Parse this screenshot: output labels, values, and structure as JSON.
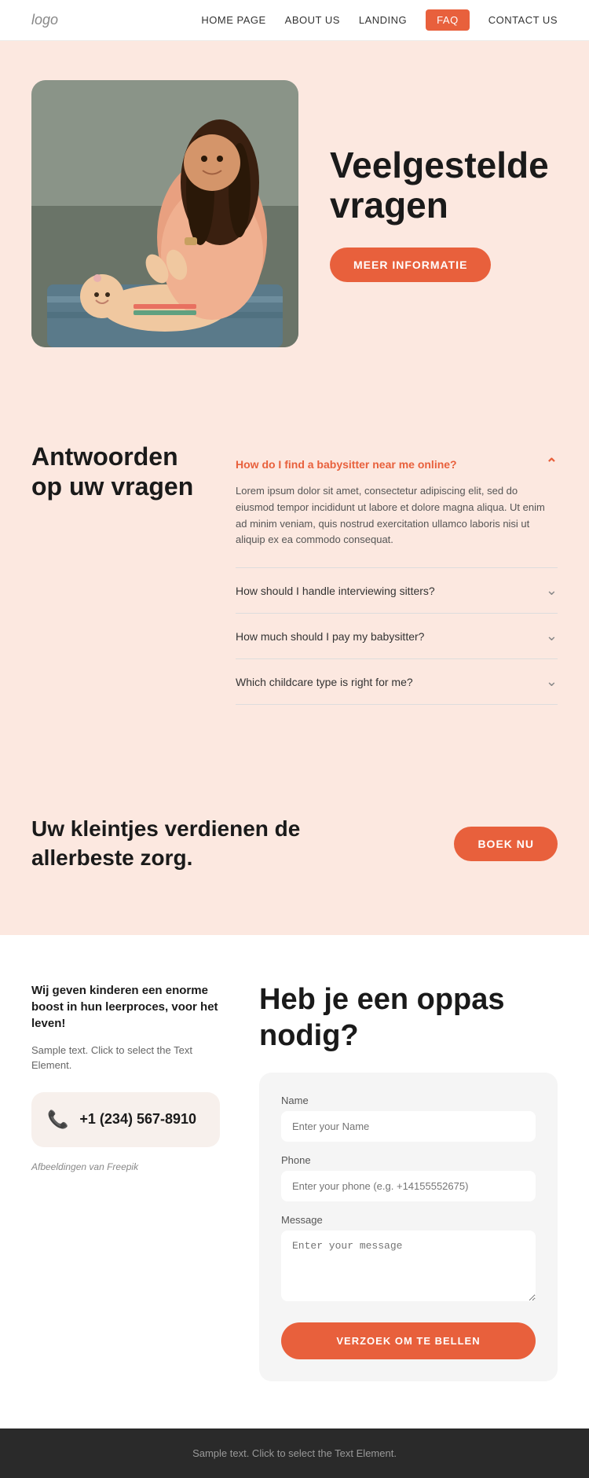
{
  "nav": {
    "logo": "logo",
    "links": [
      {
        "label": "HOME PAGE",
        "key": "home",
        "active": false
      },
      {
        "label": "ABOUT US",
        "key": "about",
        "active": false
      },
      {
        "label": "LANDING",
        "key": "landing",
        "active": false
      },
      {
        "label": "FAQ",
        "key": "faq",
        "active": true
      },
      {
        "label": "CONTACT US",
        "key": "contact",
        "active": false
      }
    ]
  },
  "hero": {
    "title": "Veelgestelde vragen",
    "cta_button": "MEER INFORMATIE"
  },
  "faq_section": {
    "heading": "Antwoorden op uw vragen",
    "items": [
      {
        "question": "How do I find a babysitter near me online?",
        "answer": "Lorem ipsum dolor sit amet, consectetur adipiscing elit, sed do eiusmod tempor incididunt ut labore et dolore magna aliqua. Ut enim ad minim veniam, quis nostrud exercitation ullamco laboris nisi ut aliquip ex ea commodo consequat.",
        "open": true
      },
      {
        "question": "How should I handle interviewing sitters?",
        "answer": "",
        "open": false
      },
      {
        "question": "How much should I pay my babysitter?",
        "answer": "",
        "open": false
      },
      {
        "question": "Which childcare type is right for me?",
        "answer": "",
        "open": false
      }
    ]
  },
  "cta_section": {
    "text": "Uw kleintjes verdienen de allerbeste zorg.",
    "button": "BOEK NU"
  },
  "contact_section": {
    "form_heading": "Heb je een oppas nodig?",
    "left_heading": "Wij geven kinderen een enorme boost in hun leerproces, voor het leven!",
    "left_subtext": "Sample text. Click to select the Text Element.",
    "phone": "+1 (234) 567-8910",
    "freepik_text": "Afbeeldingen van Freepik",
    "form": {
      "name_label": "Name",
      "name_placeholder": "Enter your Name",
      "phone_label": "Phone",
      "phone_placeholder": "Enter your phone (e.g. +14155552675)",
      "message_label": "Message",
      "message_placeholder": "Enter your message",
      "submit_button": "VERZOEK OM TE BELLEN"
    }
  },
  "footer": {
    "text": "Sample text. Click to select the Text Element."
  }
}
